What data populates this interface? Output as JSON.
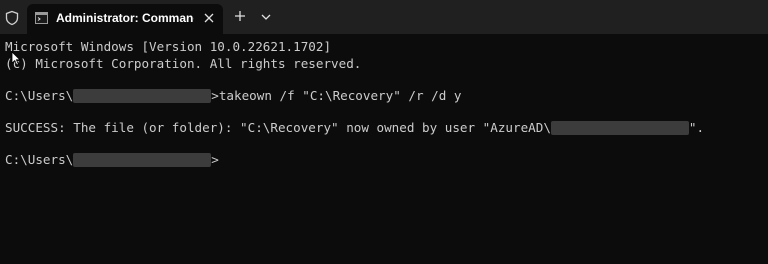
{
  "tab": {
    "title": "Administrator: Command Pro",
    "icon": "terminal-icon",
    "close_icon": "close-icon"
  },
  "titlebar": {
    "shield_icon": "shield-icon",
    "new_tab_icon": "plus-icon",
    "dropdown_icon": "chevron-down-icon"
  },
  "terminal": {
    "line1": "Microsoft Windows [Version 10.0.22621.1702]",
    "line2": "(c) Microsoft Corporation. All rights reserved.",
    "prompt1_prefix": "C:\\Users\\",
    "prompt1_command": ">takeown /f \"C:\\Recovery\" /r /d y",
    "success_prefix": "SUCCESS: The file (or folder): \"C:\\Recovery\" now owned by user \"AzureAD\\",
    "success_suffix": "\".",
    "prompt2_prefix": "C:\\Users\\",
    "prompt2_suffix": ">"
  },
  "colors": {
    "terminal_bg": "#0c0c0c",
    "titlebar_bg": "#202020",
    "text": "#cccccc",
    "redaction": "#3c3c3c"
  }
}
